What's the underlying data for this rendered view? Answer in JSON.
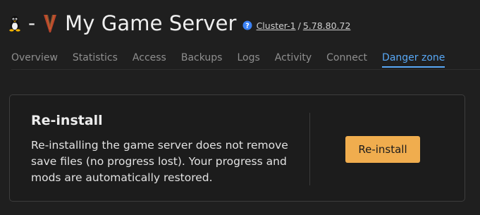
{
  "header": {
    "os_icon": "linux-penguin-icon",
    "separator": "-",
    "game_icon": "valheim-v-logo-icon",
    "server_name": "My Game Server",
    "help_icon": "question-circle-icon",
    "cluster_link": "Cluster-1",
    "meta_separator": "/",
    "ip_link": "5.78.80.72"
  },
  "tabs": [
    {
      "label": "Overview",
      "active": false
    },
    {
      "label": "Statistics",
      "active": false
    },
    {
      "label": "Access",
      "active": false
    },
    {
      "label": "Backups",
      "active": false
    },
    {
      "label": "Logs",
      "active": false
    },
    {
      "label": "Activity",
      "active": false
    },
    {
      "label": "Connect",
      "active": false
    },
    {
      "label": "Danger zone",
      "active": true
    }
  ],
  "reinstall_card": {
    "title": "Re-install",
    "description": "Re-installing the game server does not remove save files (no progress lost). Your progress and mods are automatically restored.",
    "button_label": "Re-install"
  },
  "colors": {
    "background": "#1f1f1f",
    "active_tab": "#58a8f6",
    "inactive_tab": "#8f8f8f",
    "button": "#f0ad4e",
    "help_icon": "#3b82f6"
  }
}
